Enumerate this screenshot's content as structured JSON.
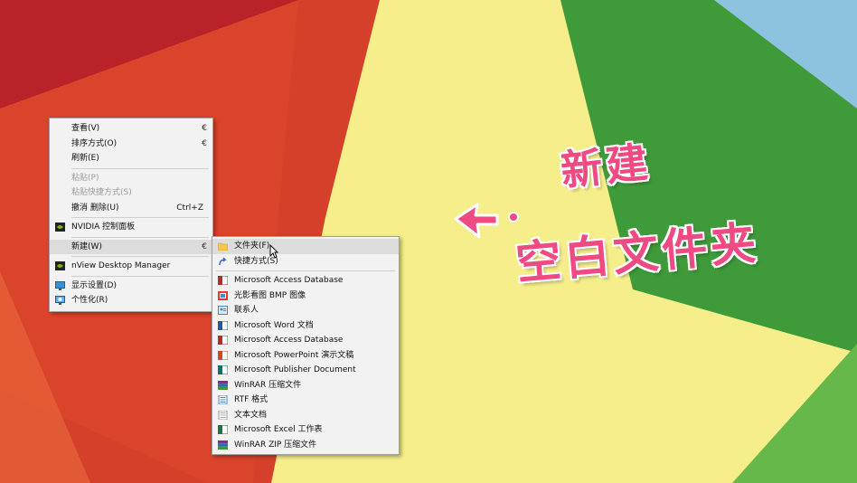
{
  "context_menu": {
    "items": [
      {
        "label": "查看(V)",
        "arrow": "€"
      },
      {
        "label": "排序方式(O)",
        "arrow": "€"
      },
      {
        "label": "刷新(E)"
      },
      {
        "label": "粘贴(P)"
      },
      {
        "label": "粘贴快捷方式(S)"
      },
      {
        "label": "撤消 删除(U)",
        "shortcut": "Ctrl+Z"
      },
      {
        "label": "NVIDIA 控制面板",
        "icon": "nvidia-icon"
      },
      {
        "label": "新建(W)",
        "arrow": "€"
      },
      {
        "label": "nView Desktop Manager",
        "icon": "nvidia-icon"
      },
      {
        "label": "显示设置(D)",
        "icon": "display-settings-icon"
      },
      {
        "label": "个性化(R)",
        "icon": "personalize-icon"
      }
    ]
  },
  "new_submenu": {
    "items": [
      {
        "label": "文件夹(F)",
        "icon": "folder-icon"
      },
      {
        "label": "快捷方式(S)",
        "icon": "shortcut-icon"
      },
      {
        "label": "Microsoft Access Database",
        "icon": "access-icon"
      },
      {
        "label": "光影看图 BMP 图像",
        "icon": "bmp-image-icon"
      },
      {
        "label": "联系人",
        "icon": "contact-icon"
      },
      {
        "label": "Microsoft Word 文档",
        "icon": "word-icon"
      },
      {
        "label": "Microsoft Access Database",
        "icon": "access-icon"
      },
      {
        "label": "Microsoft PowerPoint 演示文稿",
        "icon": "powerpoint-icon"
      },
      {
        "label": "Microsoft Publisher Document",
        "icon": "publisher-icon"
      },
      {
        "label": "WinRAR 压缩文件",
        "icon": "winrar-icon"
      },
      {
        "label": "RTF 格式",
        "icon": "rtf-icon"
      },
      {
        "label": "文本文档",
        "icon": "text-document-icon"
      },
      {
        "label": "Microsoft Excel 工作表",
        "icon": "excel-icon"
      },
      {
        "label": "WinRAR ZIP 压缩文件",
        "icon": "winrar-zip-icon"
      }
    ]
  },
  "overlay": {
    "line1": "新建",
    "line2": "空白文件夹"
  },
  "colors": {
    "wallpaper_red": "#d9442a",
    "wallpaper_yellow": "#f5ee8a",
    "wallpaper_green": "#3f9a3a",
    "wallpaper_blue": "#8ec3df",
    "overlay_pink": "#f04a83",
    "menu_bg": "#f2f2f2",
    "menu_hover": "#dcdcdc"
  }
}
